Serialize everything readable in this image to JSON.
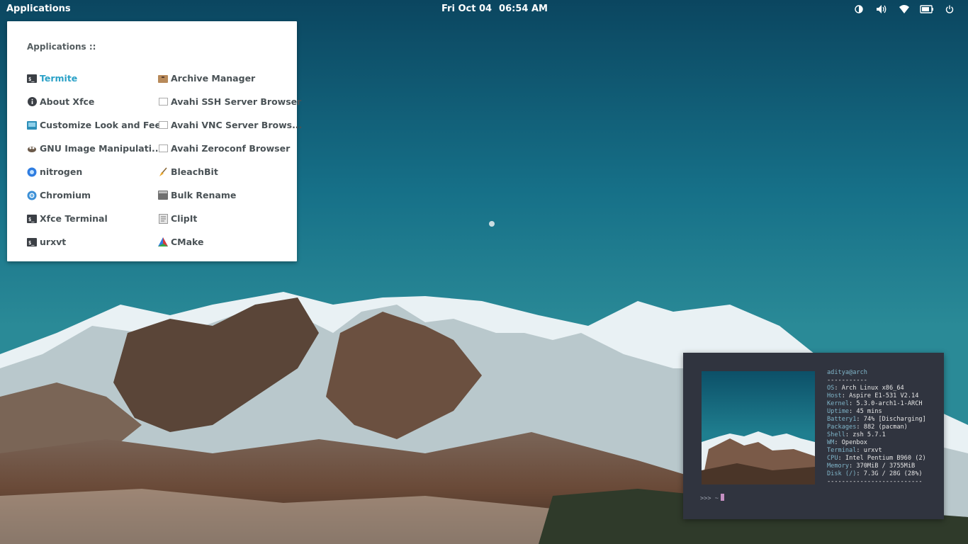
{
  "panel": {
    "apps_label": "Applications",
    "date": "Fri Oct 04",
    "time": "06:54 AM",
    "tray_icons": [
      "contrast-icon",
      "volume-icon",
      "wifi-icon",
      "battery-icon",
      "power-icon"
    ]
  },
  "menu": {
    "title": "Applications ::",
    "left_items": [
      {
        "label": "Termite",
        "icon": "terminal-icon"
      },
      {
        "label": "About Xfce",
        "icon": "info-icon"
      },
      {
        "label": "Customize Look and Feel",
        "icon": "appearance-icon"
      },
      {
        "label": "GNU Image Manipulati...",
        "icon": "gimp-icon"
      },
      {
        "label": "nitrogen",
        "icon": "nitrogen-icon"
      },
      {
        "label": "Chromium",
        "icon": "chromium-icon"
      },
      {
        "label": "Xfce Terminal",
        "icon": "terminal-icon"
      },
      {
        "label": "urxvt",
        "icon": "terminal-icon"
      }
    ],
    "right_items": [
      {
        "label": "Archive Manager",
        "icon": "archive-icon"
      },
      {
        "label": "Avahi SSH Server Browser",
        "icon": "network-icon"
      },
      {
        "label": "Avahi VNC Server Brows...",
        "icon": "network-icon"
      },
      {
        "label": "Avahi Zeroconf Browser",
        "icon": "network-icon"
      },
      {
        "label": "BleachBit",
        "icon": "bleachbit-icon"
      },
      {
        "label": "Bulk Rename",
        "icon": "rename-icon"
      },
      {
        "label": "ClipIt",
        "icon": "clipboard-icon"
      },
      {
        "label": "CMake",
        "icon": "cmake-icon"
      }
    ],
    "active_color": "#2aa1c7"
  },
  "terminal": {
    "user": "aditya@arch",
    "separator": "-----------",
    "info": [
      {
        "key": "OS",
        "value": "Arch Linux x86_64"
      },
      {
        "key": "Host",
        "value": "Aspire E1-531 V2.14"
      },
      {
        "key": "Kernel",
        "value": "5.3.0-arch1-1-ARCH"
      },
      {
        "key": "Uptime",
        "value": "45 mins"
      },
      {
        "key": "Battery1",
        "value": "74% [Discharging]"
      },
      {
        "key": "Packages",
        "value": "882 (pacman)"
      },
      {
        "key": "Shell",
        "value": "zsh 5.7.1"
      },
      {
        "key": "WM",
        "value": "Openbox"
      },
      {
        "key": "Terminal",
        "value": "urxvt"
      },
      {
        "key": "CPU",
        "value": "Intel Pentium B960 (2)"
      },
      {
        "key": "Memory",
        "value": "370MiB / 3755MiB"
      },
      {
        "key": "Disk (/)",
        "value": "7.3G / 28G (28%)"
      }
    ],
    "bottom_separator": "--------------------------",
    "prompt": ">>>  ~"
  }
}
